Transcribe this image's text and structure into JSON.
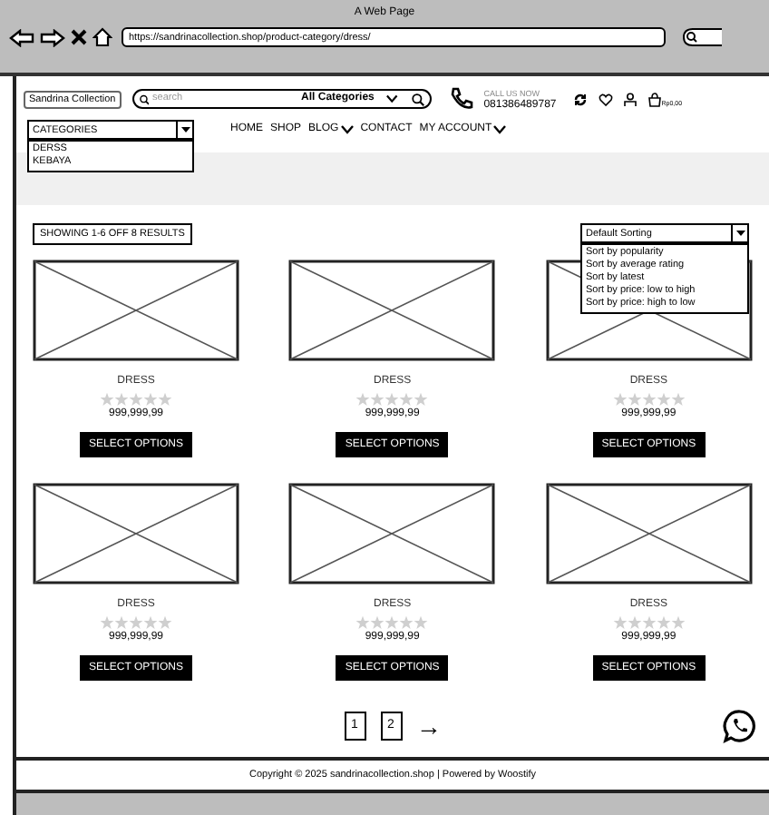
{
  "window": {
    "title": "A Web Page"
  },
  "browser": {
    "url": "https://sandrinacollection.shop/product-category/dress/"
  },
  "header": {
    "logo": "Sandrina Collection",
    "search_placeholder": "search",
    "category_select": "All Categories",
    "call_label": "CALL US NOW",
    "phone": "081386489787",
    "cart_total": "Rp0,00"
  },
  "nav": {
    "categories": {
      "label": "CATEGORIES",
      "expanded": true,
      "options": [
        "DERSS",
        "KEBAYA"
      ]
    },
    "links": [
      {
        "label": "HOME",
        "kind": "link"
      },
      {
        "label": "SHOP",
        "kind": "link"
      },
      {
        "label": "BLOG",
        "kind": "dropdown"
      },
      {
        "label": "CONTACT",
        "kind": "link"
      },
      {
        "label": "MY ACCOUNT",
        "kind": "dropdown"
      }
    ]
  },
  "results": "SHOWING 1-6 OFF 8 RESULTS",
  "sort": {
    "label": "Default Sorting",
    "expanded": true,
    "options": [
      "Sort by popularity",
      "Sort by average rating",
      "Sort by latest",
      "Sort by price: low to high",
      "Sort by price: high to low"
    ]
  },
  "products": [
    {
      "name": "DRESS",
      "stars": 0,
      "price": "999,999,99",
      "button": "SELECT OPTIONS"
    },
    {
      "name": "DRESS",
      "stars": 0,
      "price": "999,999,99",
      "button": "SELECT OPTIONS"
    },
    {
      "name": "DRESS",
      "stars": 0,
      "price": "999,999,99",
      "button": "SELECT OPTIONS"
    },
    {
      "name": "DRESS",
      "stars": 0,
      "price": "999,999,99",
      "button": "SELECT OPTIONS"
    },
    {
      "name": "DRESS",
      "stars": 0,
      "price": "999,999,99",
      "button": "SELECT OPTIONS"
    },
    {
      "name": "DRESS",
      "stars": 0,
      "price": "999,999,99",
      "button": "SELECT OPTIONS"
    }
  ],
  "pagination": {
    "pages": [
      "1",
      "2"
    ],
    "next": "→"
  },
  "footer": "Copyright © 2025 sandrinacollection.shop | Powered by Woostify"
}
